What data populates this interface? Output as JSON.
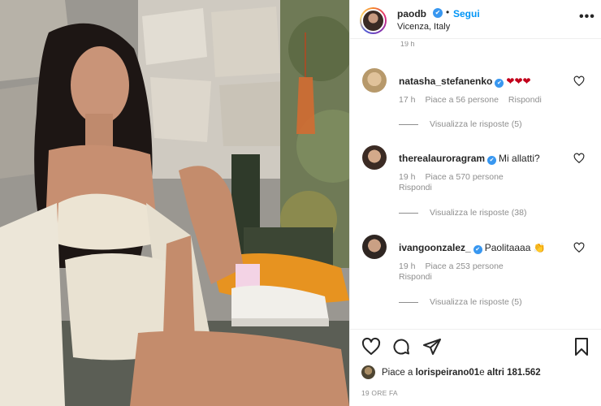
{
  "header": {
    "username": "paodb",
    "verified_mark": "✔",
    "separator": "•",
    "follow_label": "Segui",
    "location": "Vicenza, Italy",
    "more_icon": "more-options-icon",
    "more_glyph": "•••"
  },
  "comments_panel": {
    "cut_time": "19 h",
    "items": [
      {
        "username": "natasha_stefanenko",
        "verified_mark": "✔",
        "text": "",
        "emoji": "❤❤❤",
        "time": "17 h",
        "likes": "Piace a 56 persone",
        "reply": "Rispondi",
        "reply_wrapped": "",
        "view_replies": "Visualizza le risposte (5)"
      },
      {
        "username": "therealauroragram",
        "verified_mark": "✔",
        "text": "Mi allatti?",
        "emoji": "",
        "time": "19 h",
        "likes": "Piace a 570 persone",
        "reply": "",
        "reply_wrapped": "Rispondi",
        "view_replies": "Visualizza le risposte (38)"
      },
      {
        "username": "ivangoonzalez_",
        "verified_mark": "✔",
        "text": "Paolitaaaa",
        "emoji": "👏",
        "time": "19 h",
        "likes": "Piace a 253 persone",
        "reply": "",
        "reply_wrapped": "Rispondi",
        "view_replies": "Visualizza le risposte (5)"
      }
    ]
  },
  "actions": {
    "like_icon": "heart-icon",
    "comment_icon": "comment-icon",
    "share_icon": "share-icon",
    "save_icon": "bookmark-icon",
    "likes_prefix": "Piace a ",
    "likes_user": "lorispeirano01",
    "likes_middle": " e ",
    "likes_others": "altri 181.562",
    "time_ago": "19 ORE FA"
  },
  "colors": {
    "link_blue": "#0095f6",
    "verified_blue": "#3897f0",
    "muted_text": "#8e8e8e",
    "heart_red": "#c2001b"
  }
}
